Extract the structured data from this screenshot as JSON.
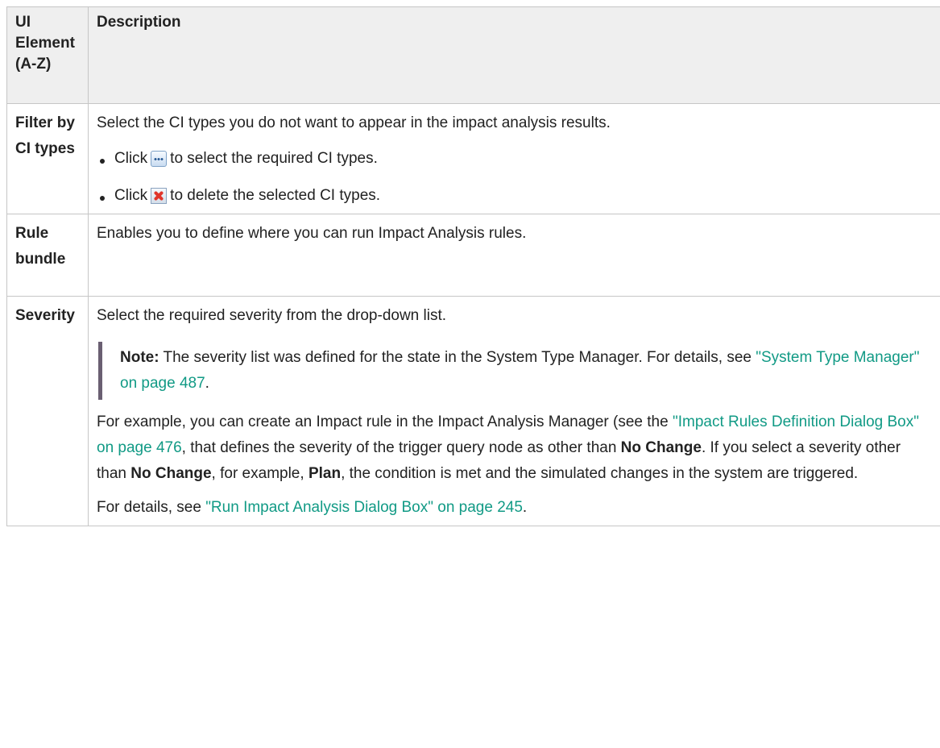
{
  "header": {
    "col1": "UI Element (A-Z)",
    "col2": "Description"
  },
  "rows": {
    "filter": {
      "element": "Filter by CI types",
      "intro": "Select the CI types you do not want to appear in the impact analysis results.",
      "bullet1_pre": "Click",
      "bullet1_post": "to select the required CI types.",
      "bullet2_pre": "Click",
      "bullet2_post": "to delete the selected CI types."
    },
    "rule": {
      "element": "Rule bundle",
      "text": "Enables you to define where you can run Impact Analysis rules."
    },
    "severity": {
      "element": "Severity",
      "intro": "Select the required severity from the drop-down list.",
      "note_label": "Note:",
      "note_text": "The severity list was defined for the state in the System Type Manager. For details, see",
      "note_link": "\"System Type Manager\" on page 487",
      "note_end": ".",
      "p2_a": "For example, you can create an Impact rule in the Impact Analysis Manager (see the",
      "p2_link": "\"Impact Rules Definition Dialog Box\" on page 476",
      "p2_b": ", that defines the severity of the trigger query node as other than",
      "p2_bold1": "No Change",
      "p2_c": ". If you select a severity other than",
      "p2_bold2": "No Change",
      "p2_d": ", for example,",
      "p2_bold3": "Plan",
      "p2_e": ", the condition is met and the simulated changes in the system are triggered.",
      "p3_a": "For details, see",
      "p3_link": "\"Run Impact Analysis Dialog Box\" on page 245",
      "p3_end": "."
    }
  },
  "icons": {
    "select": "ellipsis-button-icon",
    "delete": "delete-x-icon"
  },
  "colors": {
    "link": "#119a85",
    "header_bg": "#efefef",
    "note_bar": "#6a5f72"
  }
}
